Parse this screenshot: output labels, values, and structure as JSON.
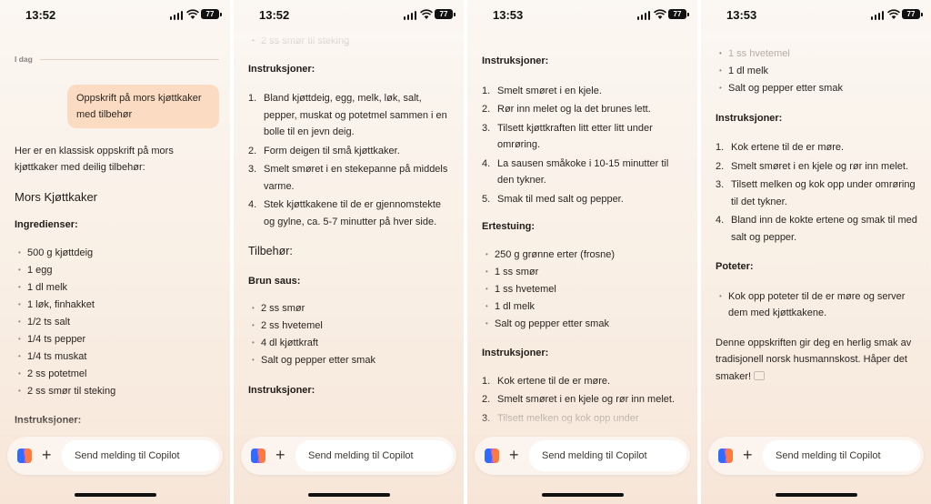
{
  "panels": [
    {
      "time": "13:52",
      "battery": "77",
      "date_label": "I dag",
      "user_message": "Oppskrift på mors kjøttkaker med tilbehør",
      "intro": "Her er en klassisk oppskrift på mors kjøttkaker med deilig tilbehør:",
      "title": "Mors Kjøttkaker",
      "ingredients_heading": "Ingredienser:",
      "ingredients": [
        "500 g kjøttdeig",
        "1 egg",
        "1 dl melk",
        "1 løk, finhakket",
        "1/2 ts salt",
        "1/4 ts pepper",
        "1/4 ts muskat",
        "2 ss potetmel",
        "2 ss smør til steking"
      ],
      "instructions_heading": "Instruksjoner:",
      "composer_placeholder": "Send melding til Copilot"
    },
    {
      "time": "13:52",
      "battery": "77",
      "faded_top": "2 ss smør til steking",
      "instructions_heading": "Instruksjoner:",
      "steps": [
        "Bland kjøttdeig, egg, melk, løk, salt, pepper, muskat og potetmel sammen i en bolle til en jevn deig.",
        "Form deigen til små kjøttkaker.",
        "Smelt smøret i en stekepanne på middels varme.",
        "Stek kjøttkakene til de er gjennomstekte og gylne, ca. 5-7 minutter på hver side."
      ],
      "sides_heading": "Tilbehør:",
      "sauce_heading": "Brun saus:",
      "sauce_items": [
        "2 ss smør",
        "2 ss hvetemel",
        "4 dl kjøttkraft",
        "Salt og pepper etter smak"
      ],
      "sauce_instr_heading": "Instruksjoner:",
      "composer_placeholder": "Send melding til Copilot"
    },
    {
      "time": "13:53",
      "battery": "77",
      "instructions_heading": "Instruksjoner:",
      "sauce_steps": [
        "Smelt smøret i en kjele.",
        "Rør inn melet og la det brunes lett.",
        "Tilsett kjøttkraften litt etter litt under omrøring.",
        "La sausen småkoke i 10-15 minutter til den tykner.",
        "Smak til med salt og pepper."
      ],
      "peas_heading": "Ertestuing:",
      "peas_items": [
        "250 g grønne erter (frosne)",
        "1 ss smør",
        "1 ss hvetemel",
        "1 dl melk",
        "Salt og pepper etter smak"
      ],
      "peas_instr_heading": "Instruksjoner:",
      "peas_steps": [
        "Kok ertene til de er møre.",
        "Smelt smøret i en kjele og rør inn melet.",
        "Tilsett melken og kok opp under"
      ],
      "composer_placeholder": "Send melding til Copilot"
    },
    {
      "time": "13:53",
      "battery": "77",
      "faded_top": "1 ss hvetemel",
      "items_top": [
        "1 dl melk",
        "Salt og pepper etter smak"
      ],
      "instructions_heading": "Instruksjoner:",
      "peas_steps": [
        "Kok ertene til de er møre.",
        "Smelt smøret i en kjele og rør inn melet.",
        "Tilsett melken og kok opp under omrøring til det tykner.",
        "Bland inn de kokte ertene og smak til med salt og pepper."
      ],
      "potato_heading": "Poteter:",
      "potato_items": [
        "Kok opp poteter til de er møre og server dem med kjøttkakene."
      ],
      "closing": "Denne oppskriften gir deg en herlig smak av tradisjonell norsk husmannskost. Håper det smaker!",
      "composer_placeholder": "Send melding til Copilot"
    }
  ],
  "colors": {
    "user_bubble": "#fbdcc2",
    "background_top": "#fbf7f2",
    "background_bottom": "#f7e6d8",
    "copilot_logo": [
      "#2f6bff",
      "#ff7a3d",
      "#a64dff"
    ]
  },
  "icons": {
    "signal": "cellular-signal-icon",
    "wifi": "wifi-icon",
    "battery": "battery-icon",
    "logo": "copilot-logo-icon",
    "plus": "plus-icon"
  }
}
